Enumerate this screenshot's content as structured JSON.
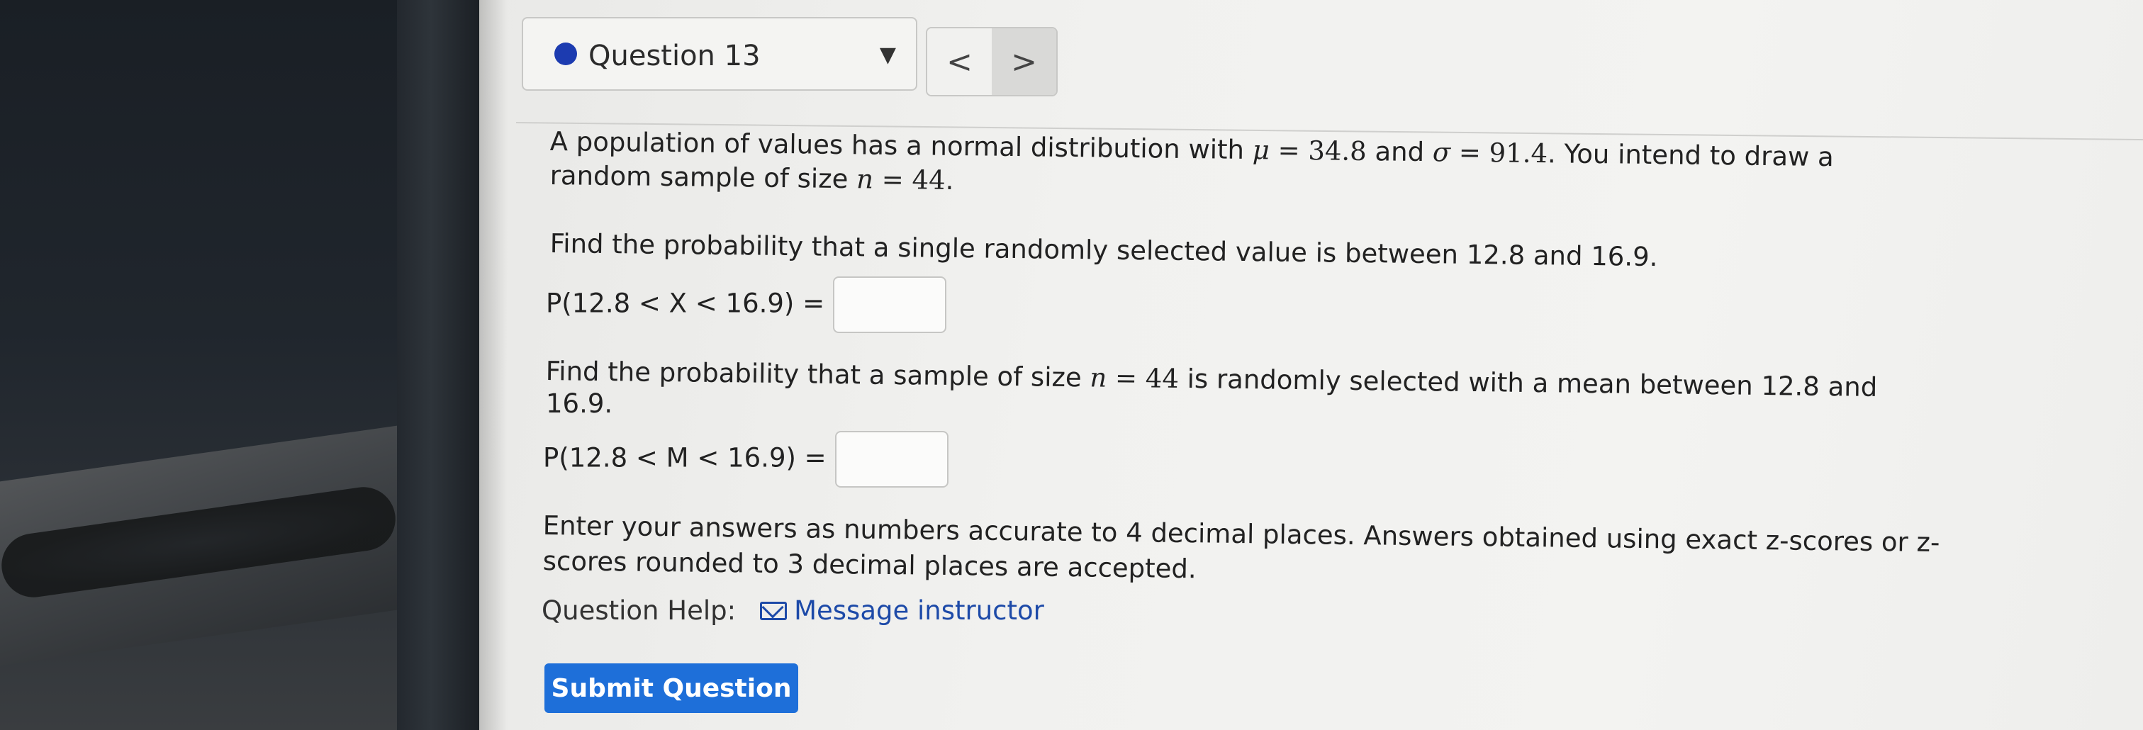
{
  "header": {
    "question_label": "Question 13",
    "dropdown_icon": "caret-down-icon",
    "prev_label": "<",
    "next_label": ">"
  },
  "problem": {
    "intro_line1_pre": "A population of values has a normal distribution with ",
    "mu_symbol": "μ",
    "mu_value": "34.8",
    "intro_and": " and ",
    "sigma_symbol": "σ",
    "sigma_value": "91.4",
    "intro_line1_post": ". You intend to draw a",
    "intro_line2_pre": "random sample of size ",
    "n_symbol": "n",
    "n_value": "44",
    "intro_line2_post": ".",
    "q1_text": "Find the probability that a single randomly selected value is between 12.8 and 16.9.",
    "q1_expr": "P(12.8 < X < 16.9) =",
    "q2_line1_pre": "Find the probability that a sample of size ",
    "q2_line1_post": " is randomly selected with a mean between 12.8 and",
    "q2_line2": "16.9.",
    "q2_expr": "P(12.8 < M < 16.9) =",
    "instr_line1": "Enter your answers as numbers accurate to 4 decimal places. Answers obtained using exact z-scores or z-",
    "instr_line2": "scores rounded to 3 decimal places are accepted."
  },
  "help": {
    "label": "Question Help:",
    "mail_icon": "envelope-icon",
    "link": "Message instructor"
  },
  "submit_label": "Submit Question",
  "colors": {
    "accent": "#1e6fd9",
    "link": "#1d4aa8",
    "dot": "#1c3bb0"
  }
}
